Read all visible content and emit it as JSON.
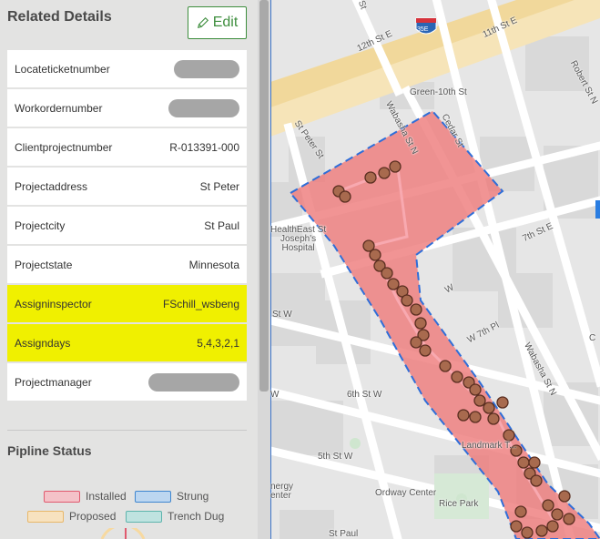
{
  "panel": {
    "title": "Related Details",
    "edit_label": "Edit",
    "rows": [
      {
        "label": "Locateticketnumber",
        "value": "",
        "redacted": true,
        "highlight": false
      },
      {
        "label": "Workordernumber",
        "value": "",
        "redacted": true,
        "highlight": false
      },
      {
        "label": "Clientprojectnumber",
        "value": "R-013391-000",
        "redacted": false,
        "highlight": false
      },
      {
        "label": "Projectaddress",
        "value": "St Peter",
        "redacted": false,
        "highlight": false
      },
      {
        "label": "Projectcity",
        "value": "St Paul",
        "redacted": false,
        "highlight": false
      },
      {
        "label": "Projectstate",
        "value": "Minnesota",
        "redacted": false,
        "highlight": false
      },
      {
        "label": "Assigninspector",
        "value": "FSchill_wsbeng",
        "redacted": false,
        "highlight": true
      },
      {
        "label": "Assigndays",
        "value": "5,4,3,2,1",
        "redacted": false,
        "highlight": true
      },
      {
        "label": "Projectmanager",
        "value": "",
        "redacted": true,
        "highlight": false
      }
    ],
    "status_title": "Pipline Status",
    "legend": [
      {
        "label": "Installed",
        "fill": "#f4c2c8",
        "border": "#e05a6e"
      },
      {
        "label": "Strung",
        "fill": "#bcd6f0",
        "border": "#3f86cf"
      },
      {
        "label": "Proposed",
        "fill": "#f7e2bf",
        "border": "#e8b86a"
      },
      {
        "label": "Trench Dug",
        "fill": "#bfe3e0",
        "border": "#5fb5ad"
      }
    ]
  },
  "map": {
    "labels": {
      "st": "St",
      "eleventh": "11th St E",
      "twelfth": "12th St E",
      "i35e": "35E",
      "green10th": "Green-10th St",
      "stpeter": "St Peter St",
      "wabasha_top": "Wabasha St N",
      "cedar": "Cedar St",
      "robert": "Robert St N",
      "healtheast": "HealthEast St\nJoseph's\nHospital",
      "seventh": "7th St E",
      "stw": "St W",
      "w7th": "W 7th Pl",
      "wabasha_bottom": "Wabasha St N",
      "sixth": "6th St W",
      "fifth": "5th St W",
      "landmark": "Landmark T...",
      "energy": "nergy\nenter",
      "ordway": "Ordway Center",
      "rice": "Rice Park",
      "stpaul": "St Paul",
      "w_edge": "W",
      "c_edge": "C"
    }
  }
}
